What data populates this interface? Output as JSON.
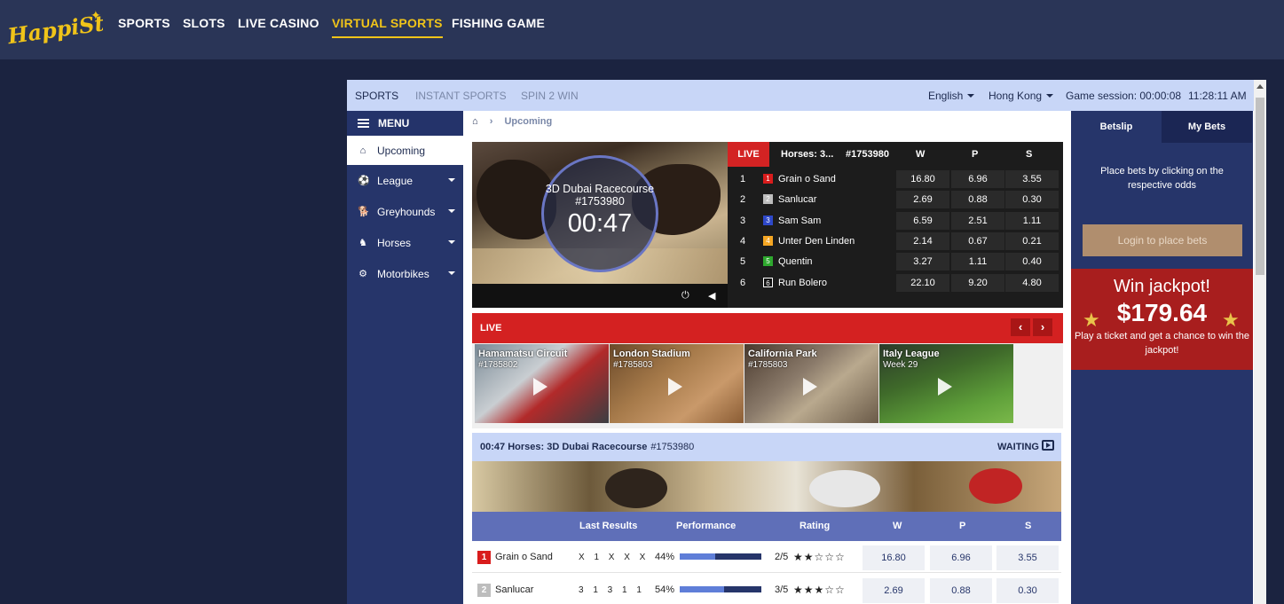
{
  "site": {
    "logo_text": "HappiStar",
    "nav": [
      "SPORTS",
      "SLOTS",
      "LIVE CASINO",
      "VIRTUAL SPORTS",
      "FISHING GAME"
    ],
    "active_nav": "VIRTUAL SPORTS"
  },
  "subbar": {
    "tabs": [
      "SPORTS",
      "INSTANT SPORTS",
      "SPIN 2 WIN"
    ],
    "language": "English",
    "timezone": "Hong Kong",
    "session": "Game session: 00:00:08",
    "clock": "11:28:11 AM"
  },
  "sidebar": {
    "menu_label": "MENU",
    "items": [
      {
        "label": "Upcoming",
        "icon": "home-icon"
      },
      {
        "label": "League",
        "icon": "soccer-ball-icon"
      },
      {
        "label": "Greyhounds",
        "icon": "greyhound-icon"
      },
      {
        "label": "Horses",
        "icon": "horse-icon"
      },
      {
        "label": "Motorbikes",
        "icon": "motorbike-icon"
      }
    ]
  },
  "breadcrumb": {
    "current": "Upcoming"
  },
  "featured": {
    "venue": "3D Dubai Racecourse",
    "race_id": "#1753980",
    "countdown": "00:47",
    "live_label": "LIVE",
    "race_short": "Horses: 3...",
    "cols": [
      "W",
      "P",
      "S"
    ],
    "runners": [
      {
        "n": "1",
        "name": "Grain o Sand",
        "w": "16.80",
        "p": "6.96",
        "s": "3.55",
        "color": "#d91c1c"
      },
      {
        "n": "2",
        "name": "Sanlucar",
        "w": "2.69",
        "p": "0.88",
        "s": "0.30",
        "color": "#bdbdbd"
      },
      {
        "n": "3",
        "name": "Sam Sam",
        "w": "6.59",
        "p": "2.51",
        "s": "1.11",
        "color": "#2e48c9"
      },
      {
        "n": "4",
        "name": "Unter Den Linden",
        "w": "2.14",
        "p": "0.67",
        "s": "0.21",
        "color": "#f5a623"
      },
      {
        "n": "5",
        "name": "Quentin",
        "w": "3.27",
        "p": "1.11",
        "s": "0.40",
        "color": "#2ea82e"
      },
      {
        "n": "6",
        "name": "Run Bolero",
        "w": "22.10",
        "p": "9.20",
        "s": "4.80",
        "color": "#111111"
      }
    ]
  },
  "live": {
    "label": "LIVE",
    "prev": "‹",
    "next": "›",
    "tiles": [
      {
        "name": "Hamamatsu Circuit",
        "sub": "#1785802"
      },
      {
        "name": "London Stadium",
        "sub": "#1785803"
      },
      {
        "name": "California Park",
        "sub": "#1785803"
      },
      {
        "name": "Italy League",
        "sub": "Week 29"
      }
    ]
  },
  "race": {
    "title": "00:47 Horses: 3D Dubai Racecourse",
    "id": "#1753980",
    "status": "WAITING",
    "headers": [
      "Last Results",
      "Performance",
      "Rating",
      "W",
      "P",
      "S"
    ],
    "rows": [
      {
        "n": "1",
        "name": "Grain o Sand",
        "last": "X 1 X X X",
        "perf": "44%",
        "perf_value": 0.44,
        "rating": "2/5",
        "stars": "★★☆☆☆",
        "w": "16.80",
        "p": "6.96",
        "s": "3.55",
        "color": "#d91c1c"
      },
      {
        "n": "2",
        "name": "Sanlucar",
        "last": "3 1 3 1 1",
        "perf": "54%",
        "perf_value": 0.54,
        "rating": "3/5",
        "stars": "★★★☆☆",
        "w": "2.69",
        "p": "0.88",
        "s": "0.30",
        "color": "#bdbdbd"
      }
    ]
  },
  "betslip": {
    "tabs": [
      "Betslip",
      "My Bets"
    ],
    "info": "Place bets by clicking on the respective odds",
    "login": "Login to place bets",
    "jackpot_title": "Win jackpot!",
    "jackpot_amount": "$179.64",
    "jackpot_desc": "Play a ticket and get a chance to win the jackpot!"
  }
}
